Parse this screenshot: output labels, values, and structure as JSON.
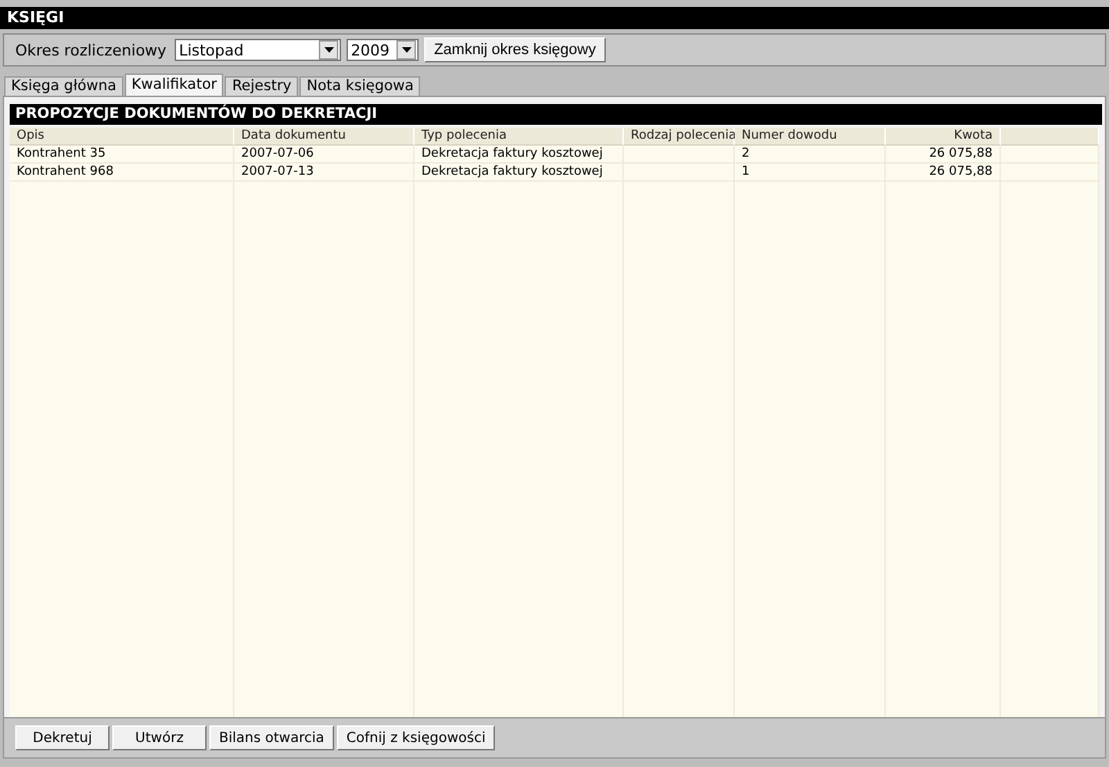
{
  "window": {
    "title": "KSIĘGI"
  },
  "period": {
    "label": "Okres rozliczeniowy",
    "month": "Listopad",
    "year": "2009",
    "close_button": "Zamknij okres księgowy"
  },
  "tabs": [
    {
      "label": "Księga główna",
      "selected": false
    },
    {
      "label": "Kwalifikator",
      "selected": true
    },
    {
      "label": "Rejestry",
      "selected": false
    },
    {
      "label": "Nota księgowa",
      "selected": false
    }
  ],
  "panel": {
    "title": "PROPOZYCJE DOKUMENTÓW DO DEKRETACJI"
  },
  "table": {
    "columns": [
      "Opis",
      "Data dokumentu",
      "Typ polecenia",
      "Rodzaj polecenia",
      "Numer dowodu",
      "Kwota"
    ],
    "rows": [
      [
        "Kontrahent 35",
        "2007-07-06",
        "Dekretacja faktury kosztowej",
        "",
        "2",
        "26 075,88"
      ],
      [
        "Kontrahent 968",
        "2007-07-13",
        "Dekretacja faktury kosztowej",
        "",
        "1",
        "26 075,88"
      ]
    ]
  },
  "buttons": [
    "Dekretuj",
    "Utwórz",
    "Bilans otwarcia",
    "Cofnij z księgowości"
  ]
}
